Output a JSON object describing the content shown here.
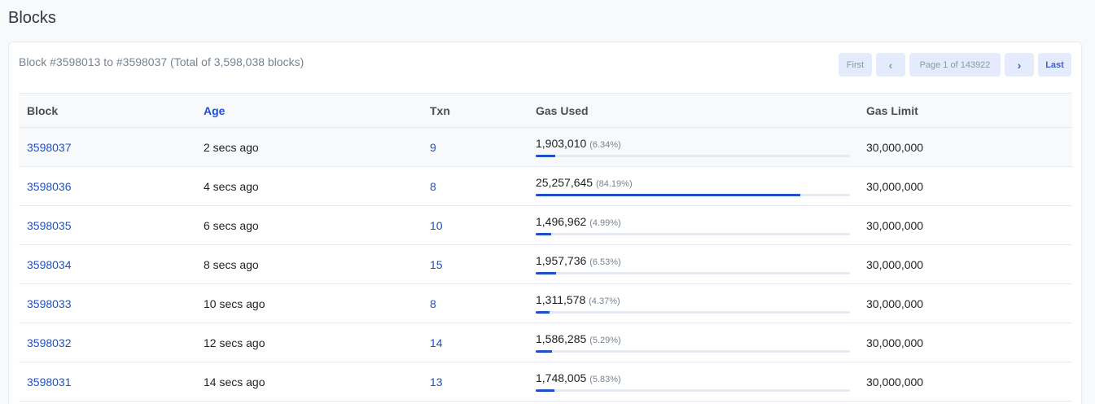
{
  "page": {
    "title": "Blocks"
  },
  "summary": "Block #3598013 to #3598037 (Total of 3,598,038 blocks)",
  "pager": {
    "first": "First",
    "info": "Page 1 of 143922",
    "last": "Last"
  },
  "colors": {
    "accent": "#1e50cc",
    "pager_bg": "#e3ebfd"
  },
  "table": {
    "headers": {
      "block": "Block",
      "age": "Age",
      "txn": "Txn",
      "gas_used": "Gas Used",
      "gas_limit": "Gas Limit"
    },
    "rows": [
      {
        "block": "3598037",
        "age": "2 secs ago",
        "txn": "9",
        "gas": "1,903,010",
        "pct": "(6.34%)",
        "fill": 6.34,
        "limit": "30,000,000"
      },
      {
        "block": "3598036",
        "age": "4 secs ago",
        "txn": "8",
        "gas": "25,257,645",
        "pct": "(84.19%)",
        "fill": 84.19,
        "limit": "30,000,000"
      },
      {
        "block": "3598035",
        "age": "6 secs ago",
        "txn": "10",
        "gas": "1,496,962",
        "pct": "(4.99%)",
        "fill": 4.99,
        "limit": "30,000,000"
      },
      {
        "block": "3598034",
        "age": "8 secs ago",
        "txn": "15",
        "gas": "1,957,736",
        "pct": "(6.53%)",
        "fill": 6.53,
        "limit": "30,000,000"
      },
      {
        "block": "3598033",
        "age": "10 secs ago",
        "txn": "8",
        "gas": "1,311,578",
        "pct": "(4.37%)",
        "fill": 4.37,
        "limit": "30,000,000"
      },
      {
        "block": "3598032",
        "age": "12 secs ago",
        "txn": "14",
        "gas": "1,586,285",
        "pct": "(5.29%)",
        "fill": 5.29,
        "limit": "30,000,000"
      },
      {
        "block": "3598031",
        "age": "14 secs ago",
        "txn": "13",
        "gas": "1,748,005",
        "pct": "(5.83%)",
        "fill": 5.83,
        "limit": "30,000,000"
      }
    ]
  }
}
